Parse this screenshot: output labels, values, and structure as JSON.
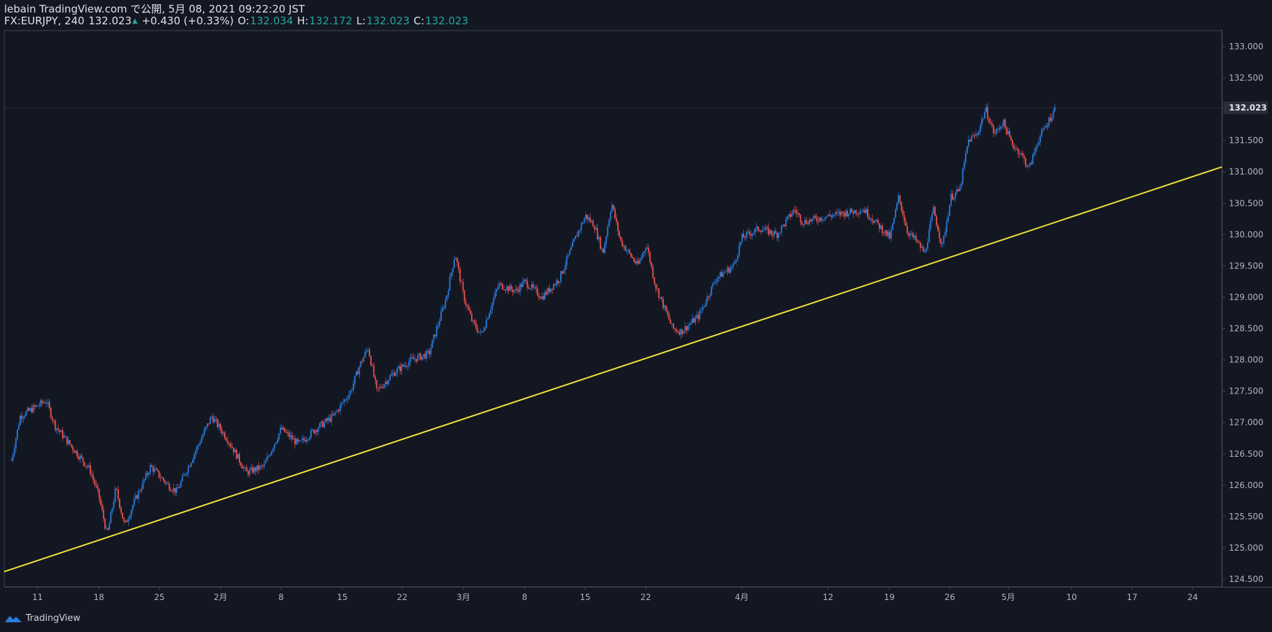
{
  "header": {
    "publish_line": "lebain TradingView.com で公開, 5月 08, 2021 09:22:20 JST",
    "symbol": "FX:EURJPY, 240",
    "last": "132.023",
    "change_arrow": "▲",
    "change": "+0.430 (+0.33%)",
    "o_label": "O:",
    "o_value": "132.034",
    "h_label": "H:",
    "h_value": "132.172",
    "l_label": "L:",
    "l_value": "132.023",
    "c_label": "C:",
    "c_value": "132.023"
  },
  "footer": {
    "brand": "TradingView"
  },
  "colors": {
    "background": "#131722",
    "up_candle": "#2a7de1",
    "down_candle": "#ef5350",
    "trendline": "#f5e33b",
    "axis_text": "#b2b5be",
    "value_change": "#26a69a"
  },
  "chart_data": {
    "type": "candlestick",
    "y_axis": {
      "min": 124.4,
      "max": 133.2,
      "ticks": [
        "133.000",
        "132.500",
        "132.000",
        "131.500",
        "131.000",
        "130.500",
        "130.000",
        "129.500",
        "129.000",
        "128.500",
        "128.000",
        "127.500",
        "127.000",
        "126.500",
        "126.000",
        "125.500",
        "125.000",
        "124.500"
      ],
      "last_price_label": "132.023"
    },
    "x_axis": {
      "labels": [
        "11",
        "18",
        "25",
        "2月",
        "8",
        "15",
        "22",
        "3月",
        "8",
        "15",
        "22",
        "4月",
        "12",
        "19",
        "26",
        "5月",
        "10",
        "17",
        "24"
      ]
    },
    "price_path": [
      {
        "t": "Jan 8",
        "p": 126.4
      },
      {
        "t": "Jan 9",
        "p": 127.1
      },
      {
        "t": "Jan 12",
        "p": 127.35
      },
      {
        "t": "Jan 13",
        "p": 126.95
      },
      {
        "t": "Jan 15",
        "p": 126.6
      },
      {
        "t": "Jan 17",
        "p": 126.25
      },
      {
        "t": "Jan 18",
        "p": 125.85
      },
      {
        "t": "Jan 19",
        "p": 125.2
      },
      {
        "t": "Jan 20",
        "p": 125.95
      },
      {
        "t": "Jan 21",
        "p": 125.35
      },
      {
        "t": "Jan 22",
        "p": 125.7
      },
      {
        "t": "Jan 24",
        "p": 126.3
      },
      {
        "t": "Jan 26",
        "p": 126.0
      },
      {
        "t": "Jan 27",
        "p": 125.9
      },
      {
        "t": "Jan 29",
        "p": 126.5
      },
      {
        "t": "Jan 31",
        "p": 127.1
      },
      {
        "t": "Feb 2",
        "p": 126.7
      },
      {
        "t": "Feb 4",
        "p": 126.2
      },
      {
        "t": "Feb 6",
        "p": 126.3
      },
      {
        "t": "Feb 8",
        "p": 126.9
      },
      {
        "t": "Feb 10",
        "p": 126.65
      },
      {
        "t": "Feb 12",
        "p": 126.9
      },
      {
        "t": "Feb 14",
        "p": 127.1
      },
      {
        "t": "Feb 16",
        "p": 127.5
      },
      {
        "t": "Feb 17",
        "p": 127.9
      },
      {
        "t": "Feb 18",
        "p": 128.2
      },
      {
        "t": "Feb 19",
        "p": 127.5
      },
      {
        "t": "Feb 21",
        "p": 127.8
      },
      {
        "t": "Feb 23",
        "p": 128.0
      },
      {
        "t": "Feb 25",
        "p": 128.1
      },
      {
        "t": "Feb 27",
        "p": 129.0
      },
      {
        "t": "Feb 28",
        "p": 129.7
      },
      {
        "t": "Mar 1",
        "p": 129.0
      },
      {
        "t": "Mar 2",
        "p": 128.6
      },
      {
        "t": "Mar 3",
        "p": 128.4
      },
      {
        "t": "Mar 5",
        "p": 129.2
      },
      {
        "t": "Mar 7",
        "p": 129.1
      },
      {
        "t": "Mar 8",
        "p": 129.25
      },
      {
        "t": "Mar 10",
        "p": 129.0
      },
      {
        "t": "Mar 12",
        "p": 129.3
      },
      {
        "t": "Mar 14",
        "p": 130.0
      },
      {
        "t": "Mar 15",
        "p": 130.3
      },
      {
        "t": "Mar 16",
        "p": 130.15
      },
      {
        "t": "Mar 17",
        "p": 129.7
      },
      {
        "t": "Mar 18",
        "p": 130.5
      },
      {
        "t": "Mar 19",
        "p": 129.9
      },
      {
        "t": "Mar 21",
        "p": 129.5
      },
      {
        "t": "Mar 22",
        "p": 129.85
      },
      {
        "t": "Mar 23",
        "p": 129.2
      },
      {
        "t": "Mar 25",
        "p": 128.5
      },
      {
        "t": "Mar 26",
        "p": 128.45
      },
      {
        "t": "Mar 28",
        "p": 128.7
      },
      {
        "t": "Mar 30",
        "p": 129.3
      },
      {
        "t": "Apr 1",
        "p": 129.5
      },
      {
        "t": "Apr 2",
        "p": 129.95
      },
      {
        "t": "Apr 4",
        "p": 130.1
      },
      {
        "t": "Apr 6",
        "p": 130.0
      },
      {
        "t": "Apr 8",
        "p": 130.4
      },
      {
        "t": "Apr 9",
        "p": 130.2
      },
      {
        "t": "Apr 12",
        "p": 130.3
      },
      {
        "t": "Apr 14",
        "p": 130.35
      },
      {
        "t": "Apr 16",
        "p": 130.4
      },
      {
        "t": "Apr 18",
        "p": 130.1
      },
      {
        "t": "Apr 19",
        "p": 129.95
      },
      {
        "t": "Apr 20",
        "p": 130.6
      },
      {
        "t": "Apr 21",
        "p": 130.05
      },
      {
        "t": "Apr 22",
        "p": 129.9
      },
      {
        "t": "Apr 23",
        "p": 129.7
      },
      {
        "t": "Apr 24",
        "p": 130.4
      },
      {
        "t": "Apr 25",
        "p": 129.8
      },
      {
        "t": "Apr 26",
        "p": 130.6
      },
      {
        "t": "Apr 27",
        "p": 130.7
      },
      {
        "t": "Apr 28",
        "p": 131.5
      },
      {
        "t": "Apr 29",
        "p": 131.6
      },
      {
        "t": "Apr 30",
        "p": 132.0
      },
      {
        "t": "May 1",
        "p": 131.6
      },
      {
        "t": "May 2",
        "p": 131.8
      },
      {
        "t": "May 3",
        "p": 131.45
      },
      {
        "t": "May 4",
        "p": 131.3
      },
      {
        "t": "May 5",
        "p": 131.05
      },
      {
        "t": "May 6",
        "p": 131.5
      },
      {
        "t": "May 7",
        "p": 131.75
      },
      {
        "t": "May 8",
        "p": 132.023
      }
    ],
    "trendline": {
      "start": {
        "t": "Jan 7",
        "p": 124.62
      },
      "end": {
        "t": "May 30",
        "p": 131.08
      }
    }
  }
}
